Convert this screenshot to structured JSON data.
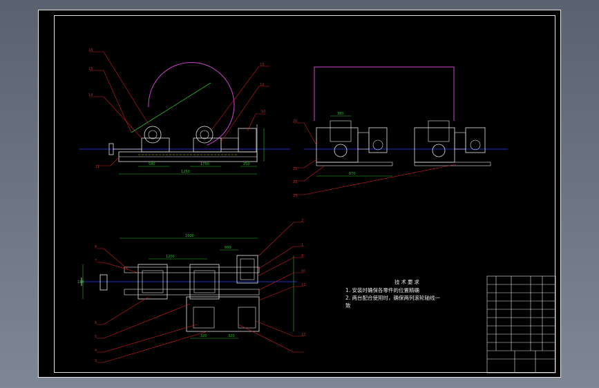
{
  "title_block": {
    "cells": [
      "",
      "",
      "",
      "",
      "",
      "",
      "",
      "",
      ""
    ]
  },
  "tech_notes": {
    "title": "技术要求",
    "lines": [
      "1. 安装时确保各零件的位置精确",
      "2. 两台配合使用时，确保两列滚轮轴线一",
      "致"
    ]
  },
  "leaders_top_view": [
    "16",
    "15",
    "14",
    "11",
    "13",
    "12",
    "10"
  ],
  "leaders_side_view": [
    "20",
    "21",
    "22",
    "23"
  ],
  "leaders_bottom_view": [
    "8",
    "7",
    "6",
    "5",
    "4",
    "3",
    "2",
    "1",
    "9",
    "10",
    "11",
    "12"
  ],
  "dimensions": {
    "top_view": [
      "1250",
      "580",
      "1750",
      "250"
    ],
    "side_view": [
      "380",
      "870"
    ],
    "bottom_view": [
      "1600",
      "600",
      "1200",
      "320",
      "320",
      "110"
    ]
  },
  "colors": {
    "background": "#000000",
    "frame": "#e8e8e8",
    "outline": "#e8e8e8",
    "leader": "#d42020",
    "dimension": "#26c426",
    "centerline": "#2a3cff",
    "guard": "#d040d0",
    "dashed": "#d4d400"
  }
}
